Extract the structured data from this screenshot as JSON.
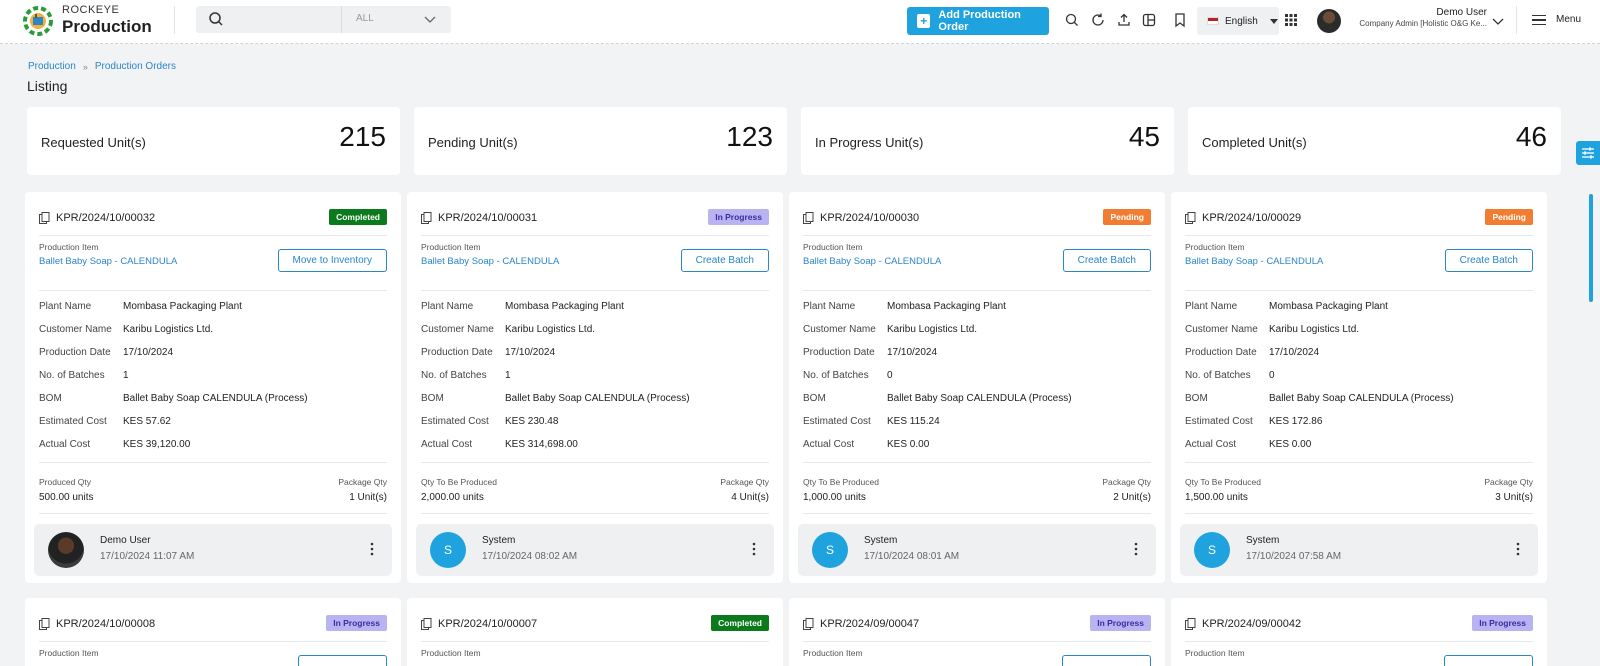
{
  "header": {
    "brand_top": "ROCKEYE",
    "brand_main": "Production",
    "search": {
      "placeholder": "",
      "scope": "ALL"
    },
    "add_button": "Add Production Order",
    "language": "English",
    "user": {
      "name": "Demo User",
      "role": "Company Admin [Holistic O&G Ke..."
    },
    "menu_label": "Menu",
    "icons": [
      "search-icon",
      "refresh-icon",
      "upload-icon",
      "layout-icon",
      "bookmark-icon",
      "apps-grid-icon"
    ]
  },
  "breadcrumb": {
    "items": [
      "Production",
      "Production Orders"
    ]
  },
  "page_title": "Listing",
  "stats": [
    {
      "label": "Requested Unit(s)",
      "value": "215"
    },
    {
      "label": "Pending Unit(s)",
      "value": "123"
    },
    {
      "label": "In Progress Unit(s)",
      "value": "45"
    },
    {
      "label": "Completed Unit(s)",
      "value": "46"
    }
  ],
  "field_labels": {
    "production_item": "Production Item",
    "plant": "Plant Name",
    "customer": "Customer Name",
    "date": "Production Date",
    "batches": "No. of Batches",
    "bom": "BOM",
    "estimated": "Estimated Cost",
    "actual": "Actual Cost",
    "package_qty": "Package Qty"
  },
  "cards": [
    {
      "code": "KPR/2024/10/00032",
      "status": "Completed",
      "item": "Ballet Baby Soap - CALENDULA",
      "action": "Move to Inventory",
      "plant": "Mombasa Packaging Plant",
      "customer": "Karibu Logistics Ltd.",
      "date": "17/10/2024",
      "batches": "1",
      "bom": "Ballet Baby Soap CALENDULA (Process)",
      "estimated": "KES 57.62",
      "actual": "KES 39,120.00",
      "qty_label": "Produced Qty",
      "qty": "500.00 units",
      "package": "1 Unit(s)",
      "user": "Demo User",
      "time": "17/10/2024 11:07 AM",
      "initial": ""
    },
    {
      "code": "KPR/2024/10/00031",
      "status": "In Progress",
      "item": "Ballet Baby Soap - CALENDULA",
      "action": "Create Batch",
      "plant": "Mombasa Packaging Plant",
      "customer": "Karibu Logistics Ltd.",
      "date": "17/10/2024",
      "batches": "1",
      "bom": "Ballet Baby Soap CALENDULA (Process)",
      "estimated": "KES 230.48",
      "actual": "KES 314,698.00",
      "qty_label": "Qty To Be Produced",
      "qty": "2,000.00 units",
      "package": "4 Unit(s)",
      "user": "System",
      "time": "17/10/2024 08:02 AM",
      "initial": "S"
    },
    {
      "code": "KPR/2024/10/00030",
      "status": "Pending",
      "item": "Ballet Baby Soap - CALENDULA",
      "action": "Create Batch",
      "plant": "Mombasa Packaging Plant",
      "customer": "Karibu Logistics Ltd.",
      "date": "17/10/2024",
      "batches": "0",
      "bom": "Ballet Baby Soap CALENDULA (Process)",
      "estimated": "KES 115.24",
      "actual": "KES 0.00",
      "qty_label": "Qty To Be Produced",
      "qty": "1,000.00 units",
      "package": "2 Unit(s)",
      "user": "System",
      "time": "17/10/2024 08:01 AM",
      "initial": "S"
    },
    {
      "code": "KPR/2024/10/00029",
      "status": "Pending",
      "item": "Ballet Baby Soap - CALENDULA",
      "action": "Create Batch",
      "plant": "Mombasa Packaging Plant",
      "customer": "Karibu Logistics Ltd.",
      "date": "17/10/2024",
      "batches": "0",
      "bom": "Ballet Baby Soap CALENDULA (Process)",
      "estimated": "KES 172.86",
      "actual": "KES 0.00",
      "qty_label": "Qty To Be Produced",
      "qty": "1,500.00 units",
      "package": "3 Unit(s)",
      "user": "System",
      "time": "17/10/2024 07:58 AM",
      "initial": "S"
    }
  ],
  "cards_row2": [
    {
      "code": "KPR/2024/10/00008",
      "status": "In Progress"
    },
    {
      "code": "KPR/2024/10/00007",
      "status": "Completed"
    },
    {
      "code": "KPR/2024/09/00047",
      "status": "In Progress"
    },
    {
      "code": "KPR/2024/09/00042",
      "status": "In Progress"
    }
  ],
  "colors": {
    "accent": "#1ea3df",
    "link": "#2b85c8",
    "completed": "#0b7a1c",
    "pending": "#f07d32",
    "in_progress": "#b9b3f2"
  }
}
